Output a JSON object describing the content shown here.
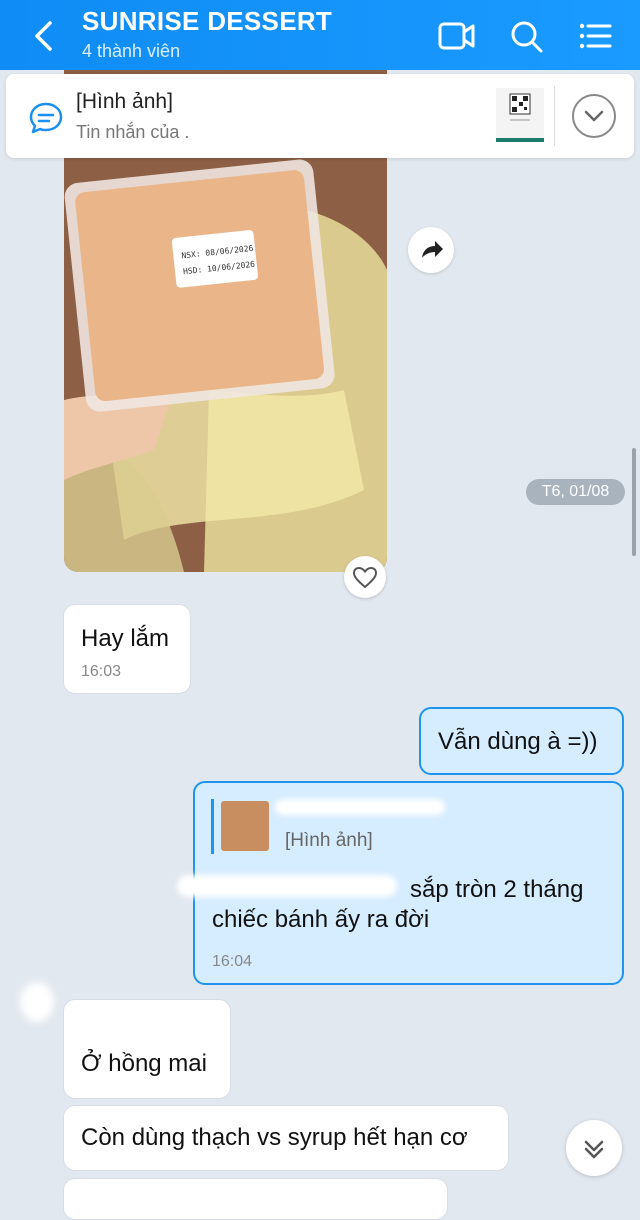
{
  "header": {
    "title": "SUNRISE DESSERT",
    "subtitle": "4 thành viên",
    "color": "#1a9bff"
  },
  "pinned": {
    "title": "[Hình ảnh]",
    "subtitle": "Tin nhắn của ."
  },
  "photo_message": {
    "label_line1": "NSX: 08/06/2026",
    "label_line2": "HSD: 10/06/2026"
  },
  "date_separator": "T6, 01/08",
  "messages": [
    {
      "direction": "in",
      "text": "Hay lắm",
      "time": "16:03"
    },
    {
      "direction": "out",
      "text": "Vẫn dùng à =))"
    },
    {
      "direction": "out",
      "quote_label": "[Hình ảnh]",
      "text_line1": "sắp tròn 2 tháng",
      "text_line2": "chiếc bánh ấy ra đời",
      "time": "16:04"
    },
    {
      "direction": "in",
      "text": "Ở hồng mai"
    },
    {
      "direction": "in",
      "text": "Còn dùng thạch vs syrup hết hạn cơ"
    }
  ],
  "icons": {
    "back": "chevron-left-icon",
    "video": "video-call-icon",
    "search": "search-icon",
    "menu": "list-menu-icon",
    "share": "forward-arrow-icon",
    "reaction": "heart-icon",
    "scroll": "double-chevron-down-icon"
  }
}
